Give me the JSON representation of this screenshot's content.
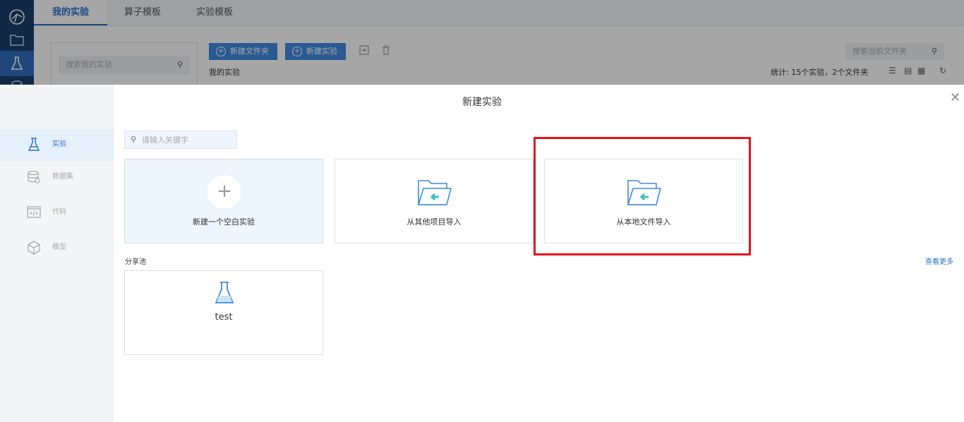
{
  "app": {
    "tabs": [
      {
        "label": "我的实验",
        "active": true
      },
      {
        "label": "算子模板",
        "active": false
      },
      {
        "label": "实验模板",
        "active": false
      }
    ],
    "sidebar_search_placeholder": "搜索我的实验",
    "new_folder_label": "新建文件夹",
    "new_experiment_label": "新建实验",
    "section_label": "我的实验",
    "stats": "统计: 15个实验，2个文件夹",
    "folder_search_placeholder": "搜索当前文件夹"
  },
  "modal": {
    "title": "新建实验",
    "nav": [
      {
        "label": "实验",
        "icon": "flask-icon",
        "active": true
      },
      {
        "label": "数据集",
        "icon": "database-icon",
        "active": false
      },
      {
        "label": "代码",
        "icon": "code-icon",
        "active": false
      },
      {
        "label": "模型",
        "icon": "cube-icon",
        "active": false
      }
    ],
    "search_placeholder": "请输入关键字",
    "options": [
      {
        "label": "新建一个空白实验",
        "icon": "plus-icon"
      },
      {
        "label": "从其他项目导入",
        "icon": "folder-import-icon"
      },
      {
        "label": "从本地文件导入",
        "icon": "folder-import-icon",
        "highlighted": true
      }
    ],
    "share_pool_label": "分享池",
    "see_more_label": "查看更多",
    "shared": [
      {
        "label": "test",
        "icon": "flask-icon"
      }
    ],
    "highlight_color": "#e8121b",
    "accent": "#2d73c8"
  }
}
